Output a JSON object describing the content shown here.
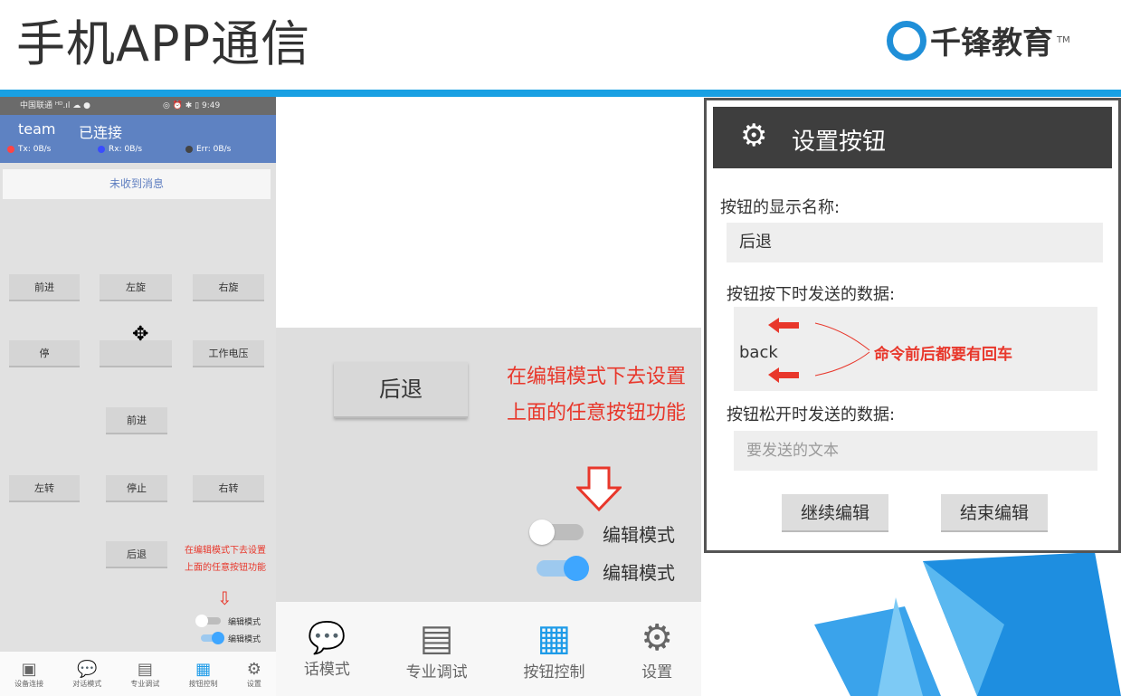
{
  "slide": {
    "title": "手机APP通信",
    "logo_text": "千锋教育",
    "logo_tm": "TM"
  },
  "phone": {
    "status_left": "中国联通 ᴴᴰ.ıl ☁ ●",
    "status_right": "◎ ⏰ ✱ ▯ 9:49",
    "device": "team",
    "connection": "已连接",
    "stats": [
      {
        "label": "Tx: 0B/s",
        "color": "#ff4444"
      },
      {
        "label": "Rx: 0B/s",
        "color": "#3a4cff"
      },
      {
        "label": "Err: 0B/s",
        "color": "#444444"
      }
    ],
    "message": "未收到消息",
    "buttons": [
      "前进",
      "左旋",
      "右旋",
      "停",
      "",
      "工作电压",
      "前进",
      "左转",
      "停止",
      "右转",
      "后退"
    ],
    "note1": "在编辑模式下去设置",
    "note2": "上面的任意按钮功能",
    "toggle_label": "编辑模式",
    "nav": [
      "设备连接",
      "对话模式",
      "专业调试",
      "按钮控制",
      "设置"
    ]
  },
  "middle": {
    "button": "后退",
    "note1": "在编辑模式下去设置",
    "note2": "上面的任意按钮功能",
    "toggle_off_label": "编辑模式",
    "toggle_on_label": "编辑模式",
    "nav": [
      "话模式",
      "专业调试",
      "按钮控制",
      "设置"
    ],
    "edit_mode_on": true
  },
  "dialog": {
    "title": "设置按钮",
    "name_label": "按钮的显示名称:",
    "name_value": "后退",
    "press_label": "按钮按下时发送的数据:",
    "press_value": "back",
    "annotation": "命令前后都要有回车",
    "release_label": "按钮松开时发送的数据:",
    "release_placeholder": "要发送的文本",
    "continue": "继续编辑",
    "finish": "结束编辑"
  }
}
